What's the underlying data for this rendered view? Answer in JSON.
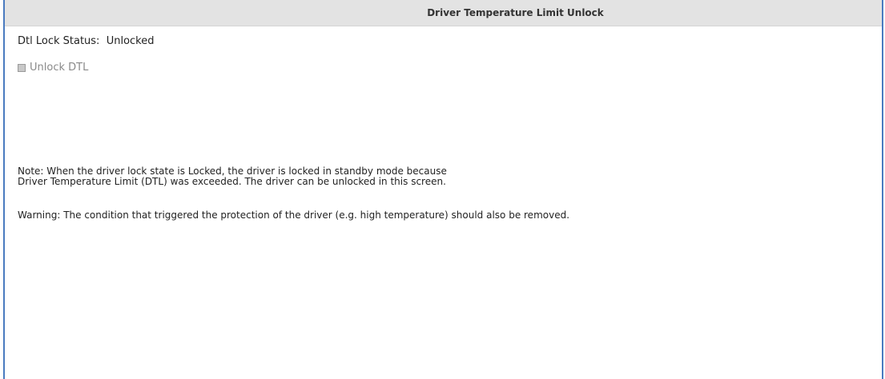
{
  "header": {
    "title": "Driver Temperature Limit Unlock"
  },
  "status": {
    "label": "Dtl Lock Status:",
    "value": "Unlocked"
  },
  "unlock": {
    "checkbox_label": "Unlock DTL",
    "checked": false,
    "enabled": false
  },
  "note": {
    "line1": "Note: When the driver lock state is Locked, the driver is locked in standby mode because",
    "line2": "Driver Temperature Limit (DTL) was exceeded. The driver can be unlocked in this screen."
  },
  "warning": {
    "text": "Warning: The condition that triggered the protection of the driver (e.g. high temperature) should also be removed."
  },
  "colors": {
    "border": "#4a7bc0",
    "title_bar": "#e3e3e3",
    "disabled_text": "#8a8a8a"
  }
}
